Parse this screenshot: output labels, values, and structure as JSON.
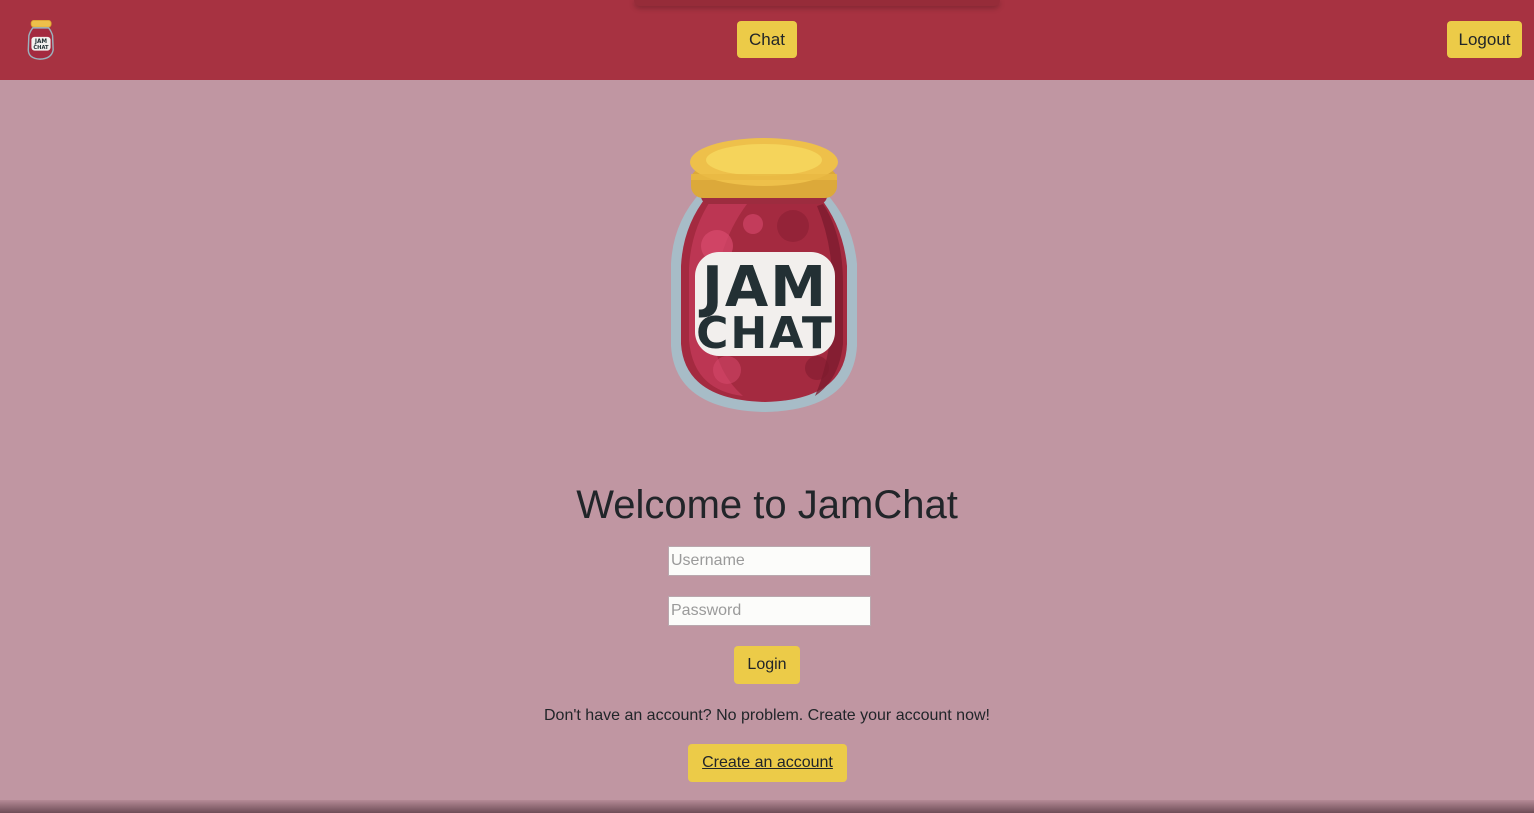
{
  "navbar": {
    "chat_label": "Chat",
    "logout_label": "Logout"
  },
  "logo": {
    "word1": "JAM",
    "word2": "CHAT"
  },
  "main": {
    "title": "Welcome to JamChat",
    "username_placeholder": "Username",
    "password_placeholder": "Password",
    "login_label": "Login",
    "signup_prompt": "Don't have an account? No problem. Create your account now!",
    "create_account_label": "Create an account"
  },
  "colors": {
    "navbar": "#a73241",
    "background": "#c096a2",
    "button": "#eccb48",
    "jam": "#a42a40",
    "lid": "#f0c84a"
  }
}
